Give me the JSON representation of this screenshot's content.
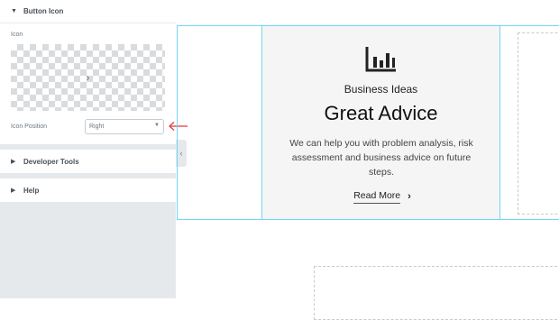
{
  "panel": {
    "button_icon_section": "Button Icon",
    "icon_label": "Icon",
    "icon_position_label": "Icon Position",
    "icon_position_value": "Right",
    "preview_icon": "chevron-right-icon",
    "developer_tools_section": "Developer Tools",
    "help_section": "Help"
  },
  "card": {
    "icon": "bar-chart-icon",
    "subtitle": "Business Ideas",
    "title": "Great Advice",
    "description": "We can help you with problem analysis, risk assessment and business advice on future steps.",
    "button_label": "Read More"
  },
  "colors": {
    "selection_outline": "#71d7f7",
    "annotation_arrow": "#e2343f",
    "panel_bg": "#e6e9ec"
  }
}
